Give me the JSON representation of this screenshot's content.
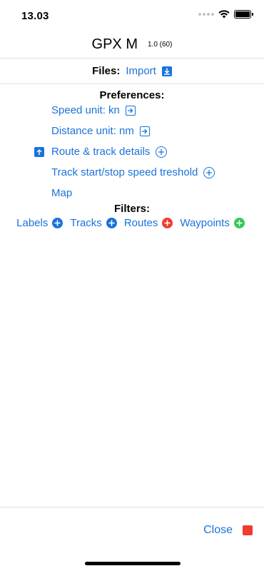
{
  "status_bar": {
    "time": "13.03",
    "wifi_icon": "wifi-icon",
    "battery_icon": "battery-icon"
  },
  "header": {
    "title": "GPX M",
    "version": "1.0 (60)"
  },
  "files": {
    "label": "Files:",
    "import_label": "Import",
    "import_icon": "download-icon"
  },
  "preferences": {
    "title": "Preferences:",
    "items": [
      {
        "label": "Speed unit: kn",
        "icon": "arrow-right-square-icon"
      },
      {
        "label": "Distance unit: nm",
        "icon": "arrow-right-square-icon"
      },
      {
        "label": "Route & track details",
        "icon": "plus-circle-icon",
        "leading_icon": "arrow-up-square-icon"
      },
      {
        "label": "Track start/stop speed treshold",
        "icon": "plus-circle-icon"
      },
      {
        "label": "Map"
      }
    ]
  },
  "filters": {
    "title": "Filters:",
    "items": [
      {
        "label": "Labels",
        "icon": "plus-circle-filled-icon",
        "color": "#1a73d9"
      },
      {
        "label": "Tracks",
        "icon": "plus-circle-filled-icon",
        "color": "#1a73d9"
      },
      {
        "label": "Routes",
        "icon": "plus-circle-filled-icon",
        "color": "#ef3b30"
      },
      {
        "label": "Waypoints",
        "icon": "plus-circle-filled-icon",
        "color": "#34c759"
      }
    ]
  },
  "footer": {
    "close_label": "Close",
    "close_icon": "stop-square-icon",
    "close_color": "#ef3b30"
  },
  "colors": {
    "accent": "#1a73d9",
    "danger": "#ef3b30",
    "success": "#34c759"
  }
}
